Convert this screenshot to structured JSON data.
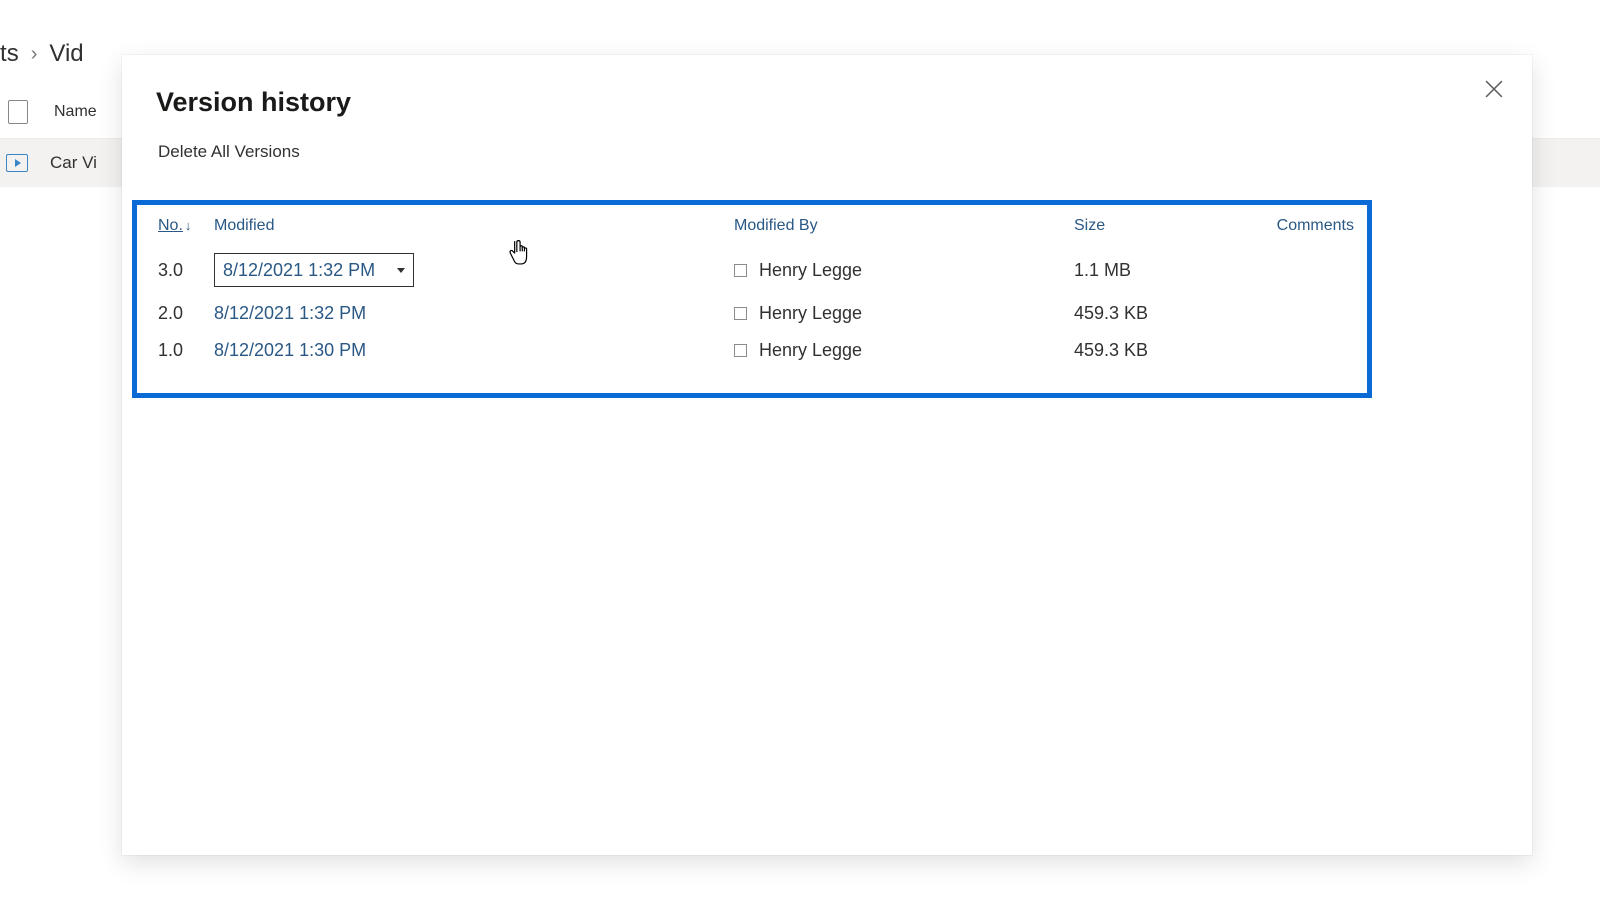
{
  "background": {
    "breadcrumb": {
      "crumb1": "nents",
      "crumb2": "Vid"
    },
    "column_label": "Name",
    "row_filename": "Car Vi"
  },
  "dialog": {
    "title": "Version history",
    "delete_all": "Delete All Versions",
    "columns": {
      "no": "No.",
      "modified": "Modified",
      "modified_by": "Modified By",
      "size": "Size",
      "comments": "Comments"
    },
    "rows": [
      {
        "no": "3.0",
        "modified": "8/12/2021 1:32 PM",
        "user": "Henry Legge",
        "size": "1.1 MB"
      },
      {
        "no": "2.0",
        "modified": "8/12/2021 1:32 PM",
        "user": "Henry Legge",
        "size": "459.3 KB"
      },
      {
        "no": "1.0",
        "modified": "8/12/2021 1:30 PM",
        "user": "Henry Legge",
        "size": "459.3 KB"
      }
    ]
  }
}
